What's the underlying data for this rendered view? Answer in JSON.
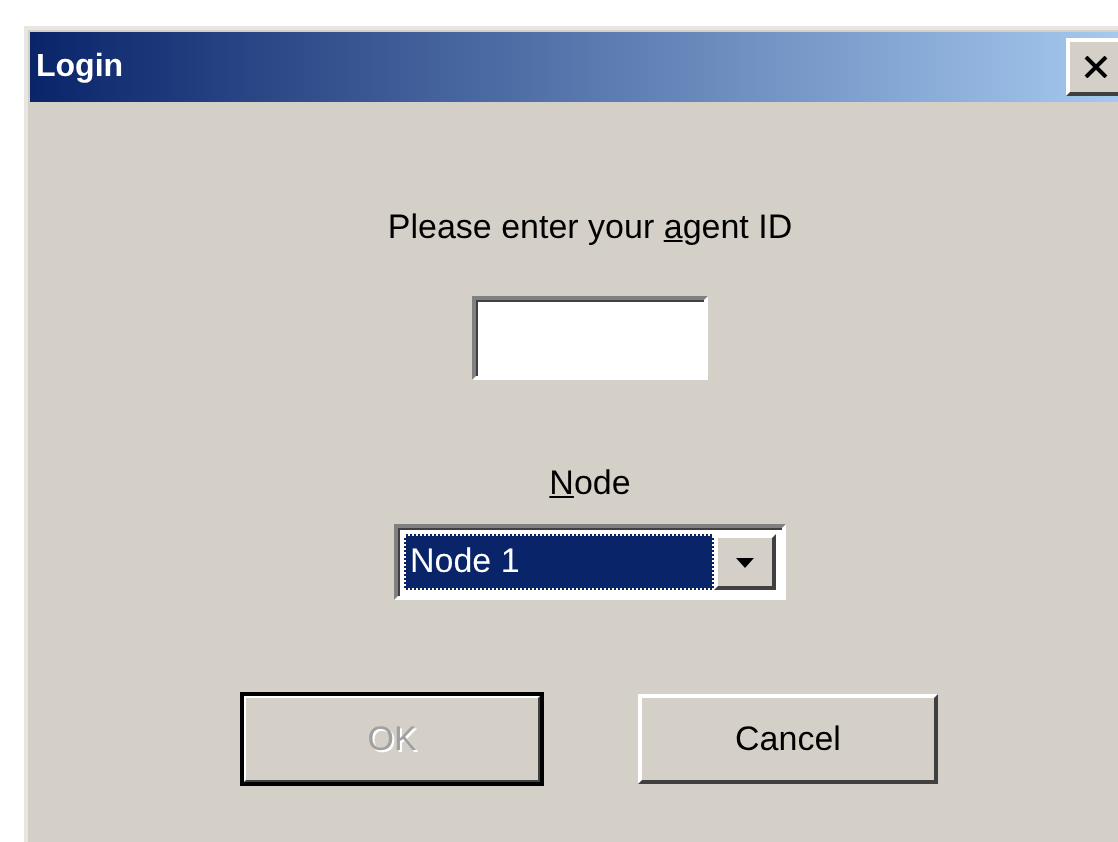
{
  "window": {
    "title": "Login"
  },
  "prompt": {
    "before": "Please enter your ",
    "access_key": "a",
    "after": "gent ID"
  },
  "node": {
    "label": {
      "access_key": "N",
      "after": "ode"
    },
    "value": "Node 1",
    "focused": true
  },
  "buttons": [
    {
      "label": "OK",
      "disabled": true,
      "default": true
    },
    {
      "label": "Cancel",
      "disabled": false,
      "default": false
    }
  ]
}
